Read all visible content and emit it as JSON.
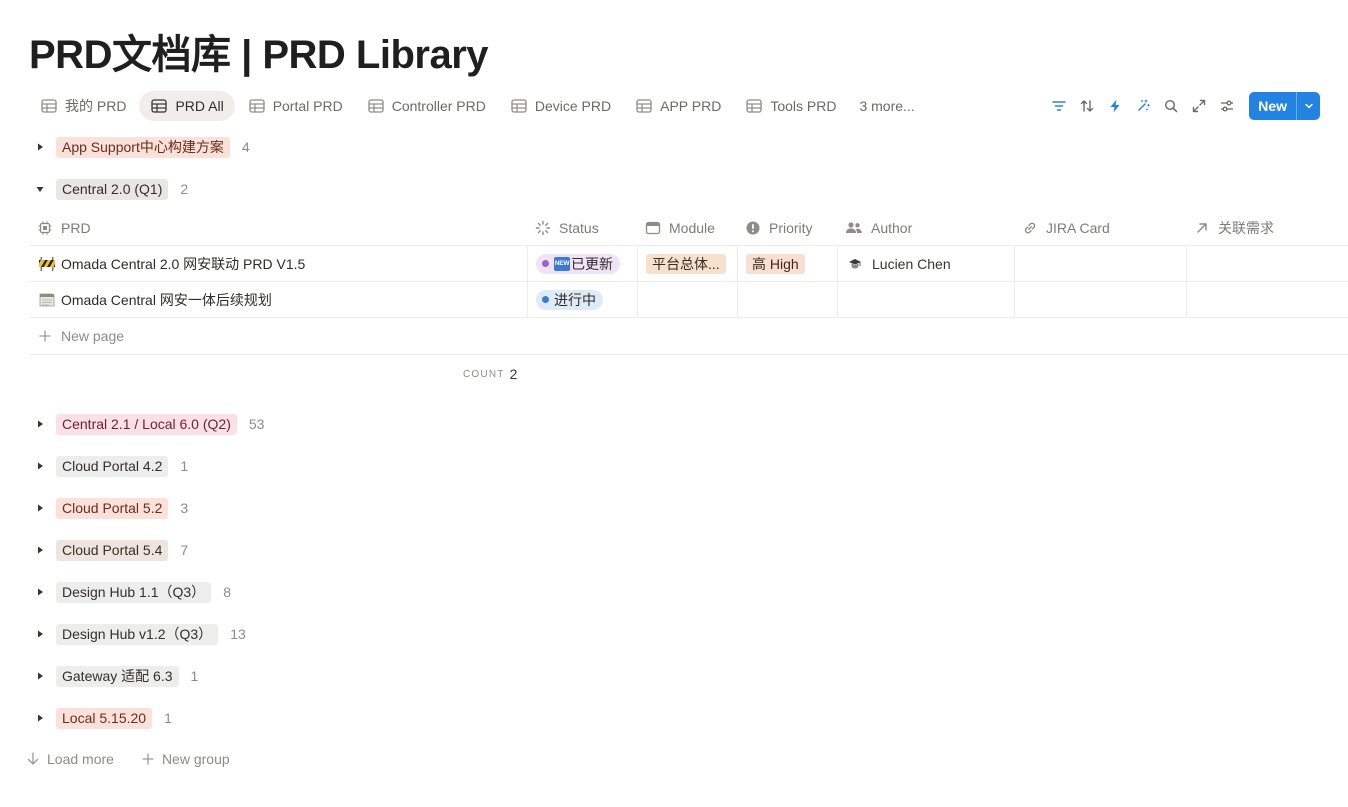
{
  "page": {
    "title": "PRD文档库 | PRD Library"
  },
  "tabs": [
    {
      "label": "我的 PRD",
      "active": false
    },
    {
      "label": "PRD All",
      "active": true
    },
    {
      "label": "Portal PRD",
      "active": false
    },
    {
      "label": "Controller PRD",
      "active": false
    },
    {
      "label": "Device PRD",
      "active": false
    },
    {
      "label": "APP PRD",
      "active": false
    },
    {
      "label": "Tools PRD",
      "active": false
    }
  ],
  "more_tabs": "3 more...",
  "toolbar": {
    "icons": [
      "filter-icon",
      "sort-icon",
      "automation-icon",
      "ai-sparkle-icon",
      "search-icon",
      "expand-icon",
      "settings-icon"
    ],
    "new_label": "New"
  },
  "groups": [
    {
      "name": "App Support中心构建方案",
      "count": "4",
      "color": "#fbe1d9",
      "text_color": "#6a2e1e",
      "expanded": false
    },
    {
      "name": "Central 2.0 (Q1)",
      "count": "2",
      "color": "#e8e7e4",
      "text_color": "#32302c",
      "expanded": true
    },
    {
      "name": "Central 2.1 / Local 6.0 (Q2)",
      "count": "53",
      "color": "#fbe0e6",
      "text_color": "#6b2436",
      "expanded": false
    },
    {
      "name": "Cloud Portal 4.2",
      "count": "1",
      "color": "#ededec",
      "text_color": "#32302c",
      "expanded": false
    },
    {
      "name": "Cloud Portal 5.2",
      "count": "3",
      "color": "#fbe1d9",
      "text_color": "#6a2e1e",
      "expanded": false
    },
    {
      "name": "Cloud Portal 5.4",
      "count": "7",
      "color": "#eee5e0",
      "text_color": "#3e2f26",
      "expanded": false
    },
    {
      "name": "Design Hub 1.1（Q3）",
      "count": "8",
      "color": "#ededec",
      "text_color": "#32302c",
      "expanded": false
    },
    {
      "name": "Design Hub v1.2（Q3）",
      "count": "13",
      "color": "#ededec",
      "text_color": "#32302c",
      "expanded": false
    },
    {
      "name": "Gateway 适配 6.3",
      "count": "1",
      "color": "#ededec",
      "text_color": "#32302c",
      "expanded": false
    },
    {
      "name": "Local 5.15.20",
      "count": "1",
      "color": "#fbe1d9",
      "text_color": "#6a2e1e",
      "expanded": false
    }
  ],
  "table": {
    "columns": [
      {
        "label": "PRD",
        "icon": "prd-chip-icon"
      },
      {
        "label": "Status",
        "icon": "status-spinner-icon"
      },
      {
        "label": "Module",
        "icon": "module-window-icon"
      },
      {
        "label": "Priority",
        "icon": "priority-alert-icon"
      },
      {
        "label": "Author",
        "icon": "people-icon"
      },
      {
        "label": "JIRA Card",
        "icon": "link-icon"
      },
      {
        "label": "关联需求",
        "icon": "relation-arrow-icon"
      }
    ],
    "rows": [
      {
        "title": "Omada Central 2.0 网安联动 PRD V1.5",
        "emoji": "construction-icon",
        "status": {
          "label": "已更新",
          "new_badge": "NEW",
          "bg": "#efe3f5",
          "dot": "#9a63c9"
        },
        "module": {
          "label": "平台总体...",
          "bg": "#f6e1cf"
        },
        "priority": {
          "label": "高 High",
          "bg": "#f9ded2"
        },
        "author": "Lucien Chen",
        "jira": "",
        "related": ""
      },
      {
        "title": "Omada Central 网安一体后续规划",
        "emoji": "document-icon",
        "status": {
          "label": "进行中",
          "bg": "#dfeaf7",
          "dot": "#3a79d4"
        },
        "module": null,
        "priority": null,
        "author": "",
        "jira": "",
        "related": ""
      }
    ],
    "new_page_label": "New page",
    "count_label": "COUNT",
    "count_value": "2"
  },
  "footer": {
    "load_more": "Load more",
    "new_group": "New group"
  }
}
